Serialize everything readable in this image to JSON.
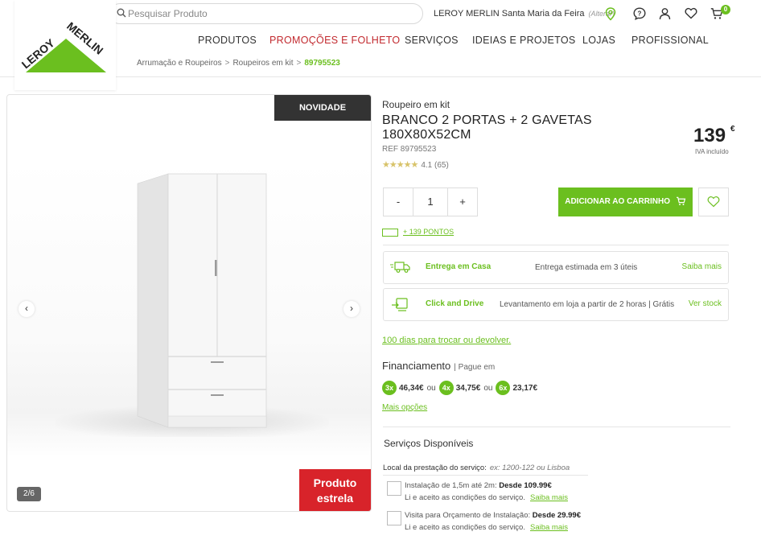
{
  "header": {
    "logo_text": "LEROY MERLIN",
    "search_placeholder": "Pesquisar Produto",
    "store_name": "LEROY MERLIN Santa Maria da Feira",
    "store_change": "(Alterar)",
    "cart_count": "0"
  },
  "nav": [
    "PRODUTOS",
    "PROMOÇÕES E FOLHETO",
    "SERVIÇOS",
    "IDEIAS E PROJETOS",
    "LOJAS",
    "PROFISSIONAL"
  ],
  "breadcrumb": [
    "Arrumação e Roupeiros",
    "Roupeiros em kit",
    "89795523"
  ],
  "gallery": {
    "badge": "NOVIDADE",
    "counter": "2/6",
    "prev": "‹",
    "next": "›",
    "promo_line1": "Produto",
    "promo_line2": "estrela"
  },
  "product": {
    "category": "Roupeiro em kit",
    "title": "BRANCO 2 PORTAS + 2 GAVETAS 180X80X52CM",
    "ref": "REF 89795523",
    "stars": "★★★★★",
    "rating": "4.1 (65)",
    "price": "139",
    "currency": "€",
    "iva": "IVA incluído"
  },
  "purchase": {
    "minus": "-",
    "qty": "1",
    "plus": "+",
    "add_to_cart": "ADICIONAR AO CARRINHO",
    "points": "+ 139 PONTOS"
  },
  "delivery": [
    {
      "title": "Entrega em Casa",
      "desc": "Entrega estimada em 3 úteis",
      "link": "Saiba mais"
    },
    {
      "title": "Click and Drive",
      "desc": "Levantamento em loja a partir de 2 horas | Grátis",
      "link": "Ver stock"
    }
  ],
  "returns_link": "100 dias para trocar ou devolver.",
  "financing": {
    "title": "Financiamento",
    "subtitle": "| Pague em",
    "plans": [
      {
        "badge": "3x",
        "value": "46,34€"
      },
      {
        "badge": "4x",
        "value": "34,75€"
      },
      {
        "badge": "6x",
        "value": "23,17€"
      }
    ],
    "separator": "ou",
    "more": "Mais opções"
  },
  "services": {
    "title": "Serviços Disponíveis",
    "location_label": "Local da prestação do serviço:",
    "location_placeholder": "ex: 1200-122 ou Lisboa",
    "items": [
      {
        "label": "Instalação de 1,5m até 2m:",
        "price": "Desde 109.99€",
        "terms": "Li e aceito as condições do serviço.",
        "link": "Saiba mais"
      },
      {
        "label": "Visita para Orçamento de Instalação:",
        "price": "Desde 29.99€",
        "terms": "Li e aceito as condições do serviço.",
        "link": "Saiba mais"
      }
    ]
  },
  "colors": {
    "brand_green": "#6bbf1f",
    "promo_red": "#d8232a",
    "dark": "#333333"
  }
}
